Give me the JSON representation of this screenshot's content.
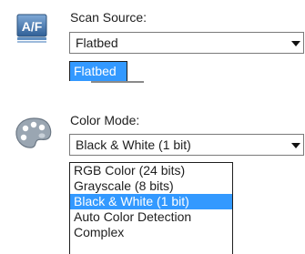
{
  "scan_source": {
    "label": "Scan Source:",
    "value": "Flatbed",
    "highlighted_option": "Flatbed",
    "icon": "scanner-af-icon"
  },
  "color_mode": {
    "label": "Color Mode:",
    "value": "Black & White (1 bit)",
    "icon": "palette-icon",
    "options": [
      "RGB Color (24 bits)",
      "Grayscale (8 bits)",
      "Black & White (1 bit)",
      "Auto Color Detection",
      "Complex"
    ],
    "selected_option": "Black & White (1 bit)"
  },
  "colors": {
    "selection": "#3399ff",
    "icon_blue": "#3a6fa8",
    "palette_gray": "#9aa6b2"
  }
}
